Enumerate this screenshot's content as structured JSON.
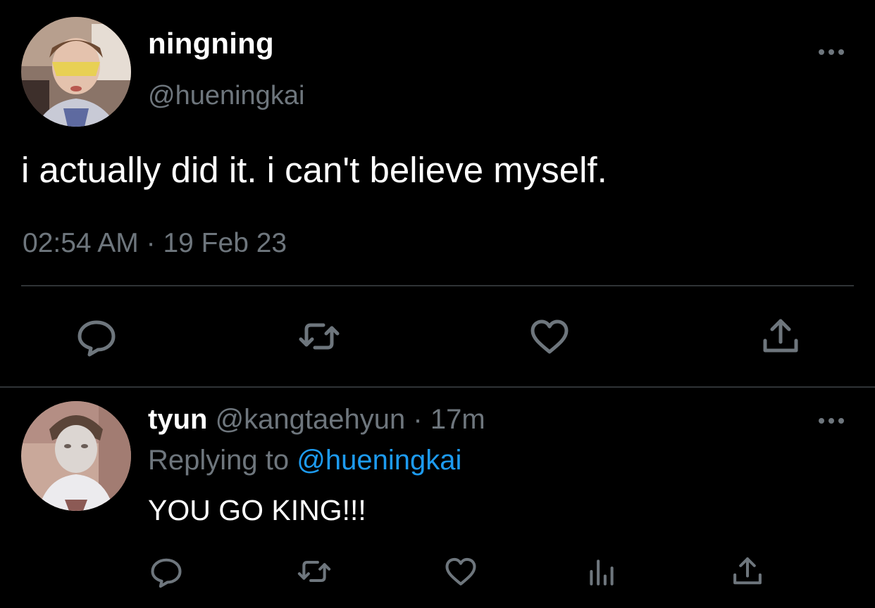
{
  "main_tweet": {
    "display_name": "ningning",
    "handle": "@hueningkai",
    "text": "i actually did it. i can't believe myself.",
    "time": "02:54 AM",
    "separator": "·",
    "date": "19 Feb 23"
  },
  "reply_tweet": {
    "display_name": "tyun",
    "handle": "@kangtaehyun",
    "separator": "·",
    "age": "17m",
    "replying_prefix": "Replying to",
    "replying_mention": "@hueningkai",
    "text": "YOU GO KING!!!"
  },
  "icons": {
    "more": "more-horizontal-icon",
    "reply": "chat-bubble-icon",
    "retweet": "retweet-icon",
    "like": "heart-icon",
    "share": "share-upload-icon",
    "analytics": "bar-chart-icon"
  },
  "colors": {
    "background": "#000000",
    "primary_text": "#ffffff",
    "secondary_text": "#6e767d",
    "link": "#1d9bf0",
    "divider": "#2f3336"
  }
}
